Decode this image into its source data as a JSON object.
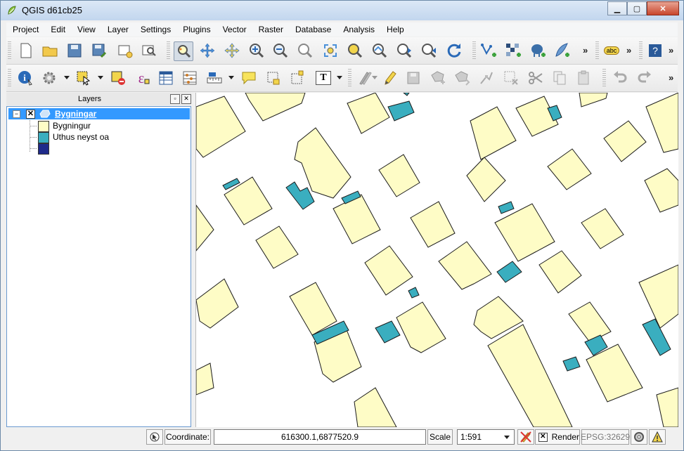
{
  "window": {
    "title": "QGIS d61cb25",
    "minimize_label": "▁",
    "maximize_label": "▢",
    "close_label": "✕"
  },
  "menu": [
    "Project",
    "Edit",
    "View",
    "Layer",
    "Settings",
    "Plugins",
    "Vector",
    "Raster",
    "Database",
    "Analysis",
    "Help"
  ],
  "toolbar": {
    "overflow": "»",
    "label_tool_text": "abc",
    "text_annotation_text": "T"
  },
  "layers_panel": {
    "title": "Layers",
    "float_label": "▫",
    "close_label": "✕",
    "expander": "−",
    "checkbox": "✕",
    "layer_name": "Bygningar",
    "legend": [
      {
        "label": "Bygningur",
        "color": "#fefcc6"
      },
      {
        "label": "Uthus neyst oa",
        "color": "#3aaebf"
      },
      {
        "label": "",
        "color": "#1f2a8a"
      }
    ]
  },
  "map": {
    "building_fill": "#fefcc6",
    "outbuilding_fill": "#3aaebf",
    "outline": "#1a1a1a"
  },
  "status": {
    "coordinate_label": "Coordinate:",
    "coordinate_value": "616300.1,6877520.9",
    "scale_label": "Scale",
    "scale_value": "1:591",
    "render_checkbox": "✕",
    "render_label": "Render",
    "crs": "EPSG:32629"
  }
}
